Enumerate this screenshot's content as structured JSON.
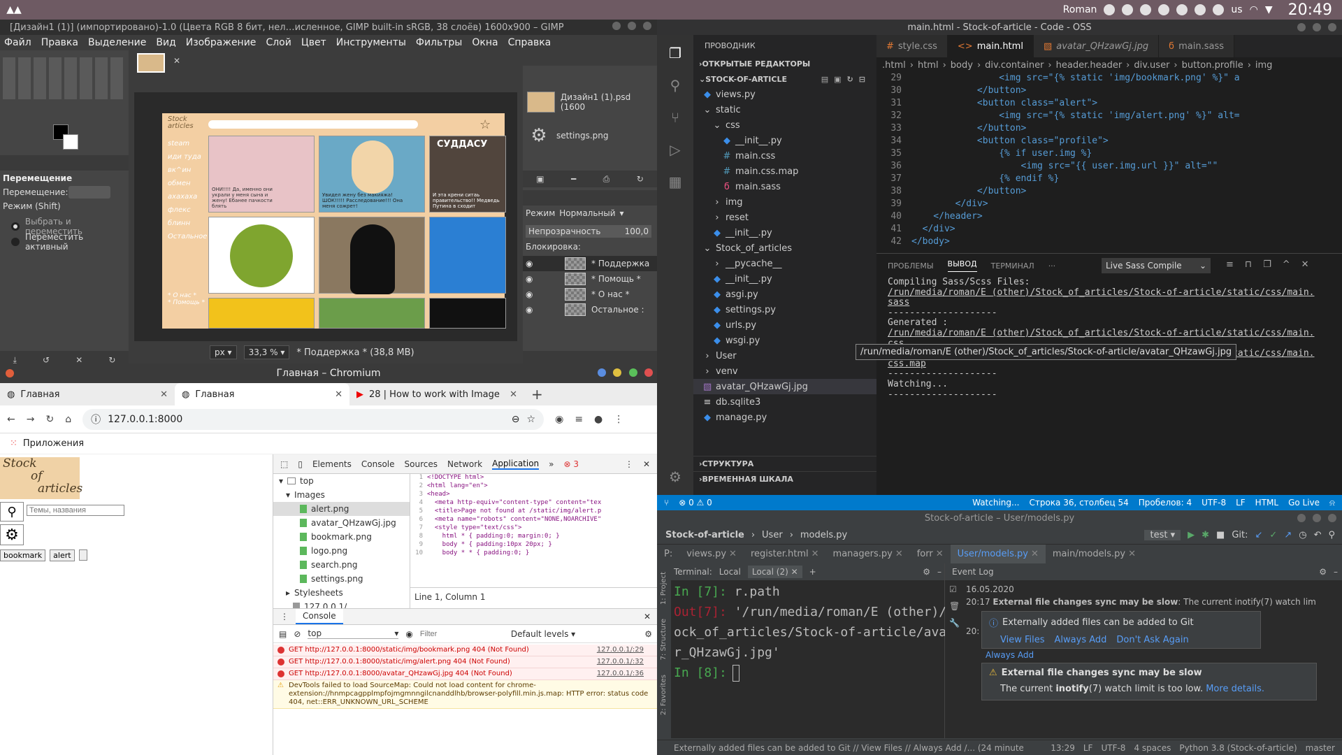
{
  "top_panel": {
    "user": "Roman",
    "keyboard_layout": "us",
    "clock": "20:49"
  },
  "gimp": {
    "title": "[Дизайн1 (1)] (импортировано)-1.0 (Цвета RGB 8 бит, нел…исленное, GIMP built-in sRGB, 38 слоёв) 1600x900 – GIMP",
    "menu": [
      "Файл",
      "Правка",
      "Выделение",
      "Вид",
      "Изображение",
      "Слой",
      "Цвет",
      "Инструменты",
      "Фильтры",
      "Окна",
      "Справка"
    ],
    "tool_options_title": "Перемещение",
    "move_label": "Перемещение:",
    "mode_label": "Режим (Shift)",
    "radio1": "Выбрать и переместить",
    "radio2": "Переместить активный",
    "unit": "px",
    "zoom": "33,3 %",
    "status": "* Поддержка * (38,8 MB)",
    "images": [
      {
        "name": "Дизайн1 (1).psd (1600"
      },
      {
        "name": "settings.png"
      }
    ],
    "layers_mode_label": "Режим",
    "layers_mode_value": "Нормальный",
    "opacity_label": "Непрозрачность",
    "opacity_value": "100,0",
    "lock_label": "Блокировка:",
    "layers": [
      "* Поддержка",
      "* Помощь *",
      "* О нас *",
      "Остальное :"
    ],
    "canvas_sidebar": [
      "steam",
      "иди туда",
      "вк^ин",
      "обмен",
      "ахахаха",
      "флекс",
      "блинн",
      "Остальное"
    ],
    "canvas_sidebar_bottom": [
      "* О нас *",
      "* Помощь *"
    ],
    "meme1_caption": "ОНИ!!!! Да, именно они украли у меня сына и жену! Ебанее пачкости блять",
    "meme2_caption": "Увидел жену без макияжа! ШОК!!!!! Расследование!!! Она меня сожрет!",
    "meme3_title": "СУДДАСУ",
    "meme3_caption": "И эта крени ситаь правительство!! Медведь Путина в сходит"
  },
  "chromium": {
    "window_title": "Главная – Chromium",
    "tabs": [
      {
        "title": "Главная"
      },
      {
        "title": "Главная"
      },
      {
        "title": "28 | How to work with Image"
      }
    ],
    "url": "127.0.0.1:8000",
    "bookmark_label": "Приложения",
    "site": {
      "logo_line1": "Stock",
      "logo_line2": "of",
      "logo_line3": "articles",
      "search_placeholder": "Темы, названия",
      "btn_bookmark": "bookmark",
      "btn_alert": "alert"
    },
    "devtools": {
      "tabs": [
        "Elements",
        "Console",
        "Sources",
        "Network",
        "Application"
      ],
      "error_count": "3",
      "tree": {
        "top": "top",
        "images": "Images",
        "files": [
          "alert.png",
          "avatar_QHzawGj.jpg",
          "bookmark.png",
          "logo.png",
          "search.png",
          "settings.png"
        ],
        "stylesheets": "Stylesheets",
        "origin": "127.0.0.1/"
      },
      "code_lines": [
        "<!DOCTYPE html>",
        "<html lang=\"en\">",
        "<head>",
        "  <meta http-equiv=\"content-type\" content=\"tex",
        "  <title>Page not found at /static/img/alert.p",
        "  <meta name=\"robots\" content=\"NONE,NOARCHIVE\"",
        "  <style type=\"text/css\">",
        "    html * { padding:0; margin:0; }",
        "    body * { padding:10px 20px; }",
        "    body * * { padding:0; }"
      ],
      "cursor_info": "Line 1, Column 1",
      "console_label": "Console",
      "context": "top",
      "filter_placeholder": "Filter",
      "levels": "Default levels",
      "messages": [
        {
          "text": "GET http://127.0.0.1:8000/static/img/bookmark.png 404 (Not Found)",
          "src": "127.0.0.1/:29"
        },
        {
          "text": "GET http://127.0.0.1:8000/static/img/alert.png 404 (Not Found)",
          "src": "127.0.0.1/:32"
        },
        {
          "text": "GET http://127.0.0.1:8000/avatar_QHzawGj.jpg 404 (Not Found)",
          "src": "127.0.0.1/:36"
        }
      ],
      "warning": "DevTools failed to load SourceMap: Could not load content for chrome-extension://hnmpcagpplmpfojmgmnngilcnanddlhb/browser-polyfill.min.js.map: HTTP error: status code 404, net::ERR_UNKNOWN_URL_SCHEME"
    }
  },
  "vscode": {
    "title": "main.html - Stock-of-article - Code - OSS",
    "explorer_title": "ПРОВОДНИК",
    "open_editors": "ОТКРЫТЫЕ РЕДАКТОРЫ",
    "project": "STOCK-OF-ARTICLE",
    "tree": [
      {
        "label": "views.py",
        "indent": 1,
        "kind": "py"
      },
      {
        "label": "static",
        "indent": 1,
        "kind": "folder-open"
      },
      {
        "label": "css",
        "indent": 2,
        "kind": "folder-open"
      },
      {
        "label": "__init__.py",
        "indent": 3,
        "kind": "py"
      },
      {
        "label": "main.css",
        "indent": 3,
        "kind": "css"
      },
      {
        "label": "main.css.map",
        "indent": 3,
        "kind": "css"
      },
      {
        "label": "main.sass",
        "indent": 3,
        "kind": "sass"
      },
      {
        "label": "img",
        "indent": 2,
        "kind": "folder"
      },
      {
        "label": "reset",
        "indent": 2,
        "kind": "folder"
      },
      {
        "label": "__init__.py",
        "indent": 2,
        "kind": "py"
      },
      {
        "label": "Stock_of_articles",
        "indent": 1,
        "kind": "folder-open"
      },
      {
        "label": "__pycache__",
        "indent": 2,
        "kind": "folder"
      },
      {
        "label": "__init__.py",
        "indent": 2,
        "kind": "py"
      },
      {
        "label": "asgi.py",
        "indent": 2,
        "kind": "py"
      },
      {
        "label": "settings.py",
        "indent": 2,
        "kind": "py"
      },
      {
        "label": "urls.py",
        "indent": 2,
        "kind": "py"
      },
      {
        "label": "wsgi.py",
        "indent": 2,
        "kind": "py"
      },
      {
        "label": "User",
        "indent": 1,
        "kind": "folder"
      },
      {
        "label": "venv",
        "indent": 1,
        "kind": "folder"
      },
      {
        "label": "avatar_QHzawGj.jpg",
        "indent": 1,
        "kind": "img"
      },
      {
        "label": "db.sqlite3",
        "indent": 1,
        "kind": "db"
      },
      {
        "label": "manage.py",
        "indent": 1,
        "kind": "py"
      }
    ],
    "outline": "СТРУКТУРА",
    "timeline": "ВРЕМЕННАЯ ШКАЛА",
    "tooltip": "/run/media/roman/E (other)/Stock_of_articles/Stock-of-article/avatar_QHzawGj.jpg",
    "tabs": [
      "style.css",
      "main.html",
      "avatar_QHzawGj.jpg",
      "main.sass"
    ],
    "breadcrumb": [
      ".html",
      "html",
      "body",
      "div.container",
      "header.header",
      "div.user",
      "button.profile",
      "img"
    ],
    "code": [
      {
        "n": "29",
        "t": "                <img src=\"{% static 'img/bookmark.png' %}\" a"
      },
      {
        "n": "30",
        "t": "            </button>"
      },
      {
        "n": "31",
        "t": "            <button class=\"alert\">"
      },
      {
        "n": "32",
        "t": "                <img src=\"{% static 'img/alert.png' %}\" alt="
      },
      {
        "n": "33",
        "t": "            </button>"
      },
      {
        "n": "34",
        "t": "            <button class=\"profile\">"
      },
      {
        "n": "35",
        "t": "                {% if user.img %}"
      },
      {
        "n": "36",
        "t": "                    <img src=\"{{ user.img.url }}\" alt=\"\""
      },
      {
        "n": "37",
        "t": "                {% endif %}"
      },
      {
        "n": "38",
        "t": "            </button>"
      },
      {
        "n": "39",
        "t": "        </div>"
      },
      {
        "n": "40",
        "t": "    </header>"
      },
      {
        "n": "41",
        "t": "  </div>"
      },
      {
        "n": "42",
        "t": "</body>"
      }
    ],
    "panel_tabs": [
      "ПРОБЛЕМЫ",
      "ВЫВОД",
      "ТЕРМИНАЛ"
    ],
    "panel_select": "Live Sass Compile",
    "output": [
      "Compiling Sass/Scss Files:",
      "/run/media/roman/E (other)/Stock_of_articles/Stock-of-article/static/css/main.",
      "sass",
      "--------------------",
      "Generated :",
      "/run/media/roman/E (other)/Stock_of_articles/Stock-of-article/static/css/main.",
      "css",
      "/run/media/roman/E (other)/Stock_of_articles/Stock-of-article/static/css/main.",
      "css.map",
      "--------------------",
      "Watching...",
      "--------------------"
    ],
    "status": {
      "problems": "0",
      "warnings": "0",
      "watching": "Watching...",
      "position": "Строка 36, столбец 54",
      "spaces": "Пробелов: 4",
      "encoding": "UTF-8",
      "eol": "LF",
      "lang": "HTML",
      "golive": "Go Live"
    }
  },
  "pycharm": {
    "title": "Stock-of-article – User/models.py",
    "nav": [
      "Stock-of-article",
      "User",
      "models.py"
    ],
    "run_config": "test",
    "git_label": "Git:",
    "tabs": [
      "P:",
      "views.py",
      "register.html",
      "managers.py",
      "forr",
      "User/models.py",
      "main/models.py"
    ],
    "terminal_label": "Terminal:",
    "terminal_tabs": [
      "Local",
      "Local (2)"
    ],
    "terminal_lines": [
      {
        "prompt": "In [7]:",
        "text": " r.path"
      },
      {
        "prompt": "Out[7]:",
        "text": " '/run/media/roman/E (other)/St"
      },
      {
        "prompt": "",
        "text": "ock_of_articles/Stock-of-article/avata"
      },
      {
        "prompt": "",
        "text": "r_QHzawGj.jpg'"
      },
      {
        "prompt": "In [8]:",
        "text": ""
      }
    ],
    "eventlog_title": "Event Log",
    "event_date": "16.05.2020",
    "event_time": "20:17",
    "event_text_bold": "External file changes sync may be slow",
    "event_text": ": The current inotify(7) watch lim",
    "notif1": {
      "text": "Externally added files can be added to Git",
      "links": [
        "View Files",
        "Always Add",
        "Don't Ask Again"
      ]
    },
    "time_partial": "20:",
    "always_add": "Always Add",
    "notif2": {
      "title": "External file changes sync may be slow",
      "text_pre": "The current ",
      "text_bold": "inotify",
      "text_post": "(7) watch limit is too low. ",
      "link": "More details."
    },
    "side_labels": [
      "1: Project",
      "7: Structure",
      "2: Favorites"
    ],
    "bottom_tabs": [
      "9: Git",
      "6: TODO",
      "Terminal",
      "Python Console"
    ],
    "event_log_tab": "Event Log",
    "status": "Externally added files can be added to Git // View Files // Always Add /... (24 minutes ago)",
    "status_right": [
      "13:29",
      "LF",
      "UTF-8",
      "4 spaces",
      "Python 3.8 (Stock-of-article)",
      "master"
    ]
  }
}
